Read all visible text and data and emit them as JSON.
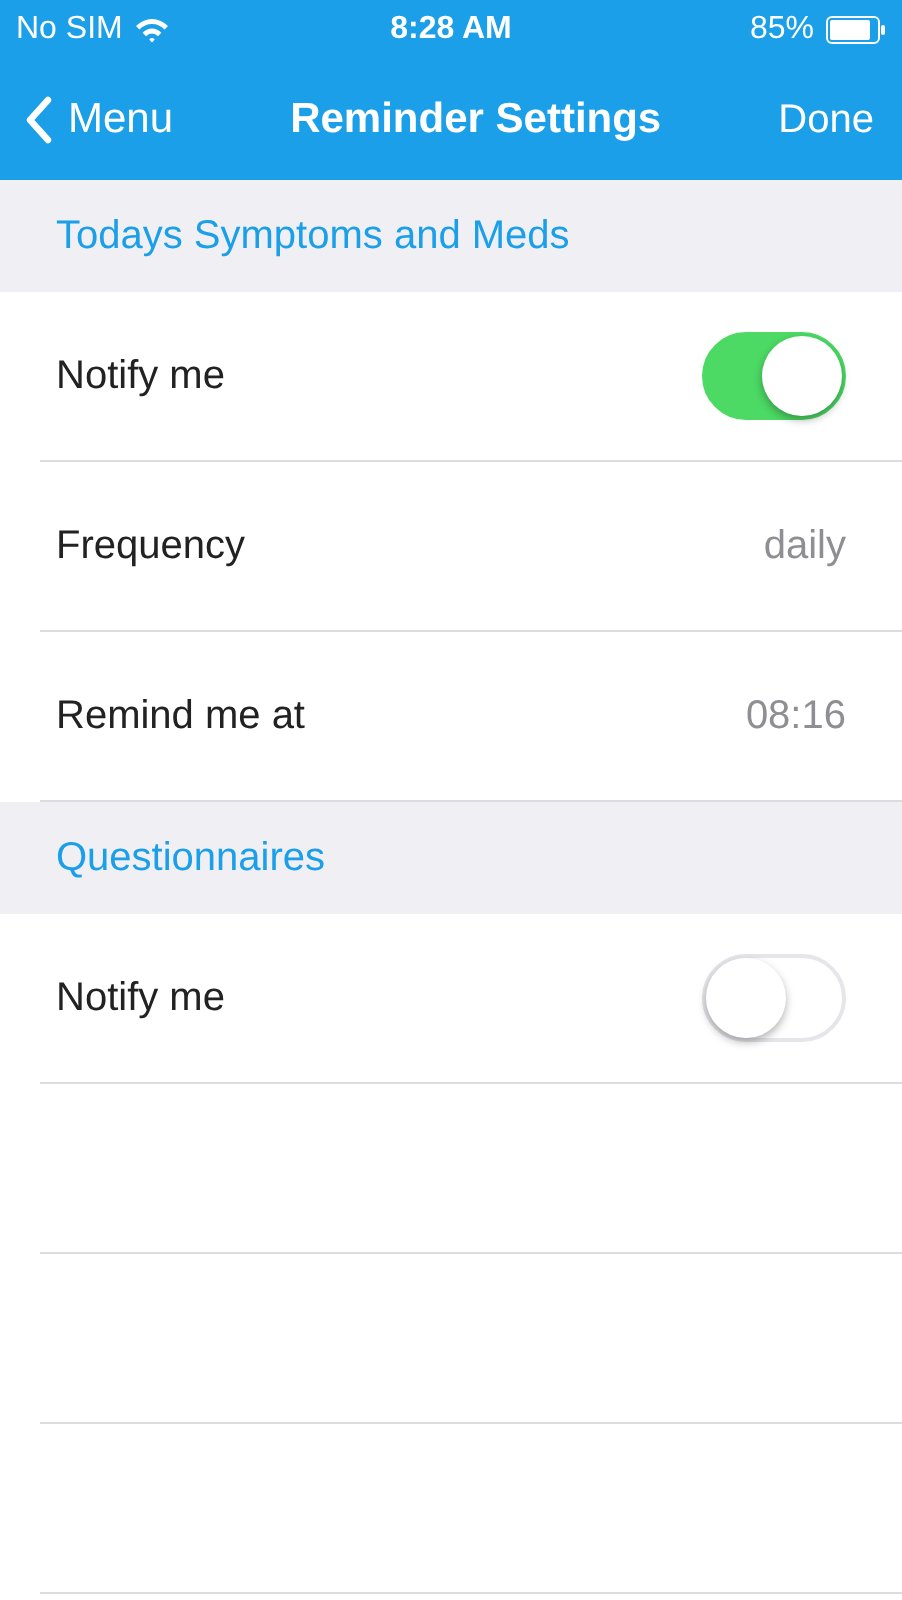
{
  "status_bar": {
    "carrier": "No SIM",
    "time": "8:28 AM",
    "battery": "85%"
  },
  "nav": {
    "back": "Menu",
    "title": "Reminder Settings",
    "action": "Done"
  },
  "sections": [
    {
      "title": "Todays Symptoms and Meds",
      "rows": [
        {
          "kind": "toggle",
          "label": "Notify me",
          "on": true
        },
        {
          "kind": "value",
          "label": "Frequency",
          "value": "daily"
        },
        {
          "kind": "value",
          "label": "Remind me at",
          "value": "08:16"
        }
      ]
    },
    {
      "title": "Questionnaires",
      "rows": [
        {
          "kind": "toggle",
          "label": "Notify me",
          "on": false
        }
      ]
    }
  ]
}
